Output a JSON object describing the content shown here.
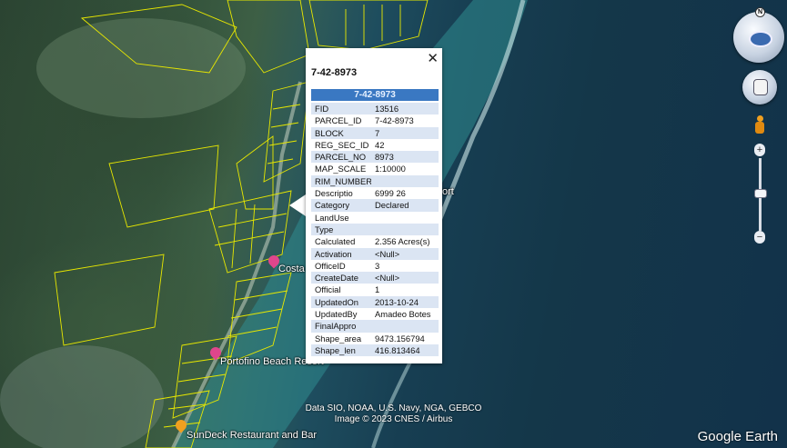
{
  "map": {
    "labels": {
      "costa": "Costa",
      "portofino": "Portofino Beach Resort",
      "sundeck": "SunDeck Restaurant and Bar",
      "ort": "ort"
    },
    "credits": {
      "line1": "Data SIO, NOAA, U.S. Navy, NGA, GEBCO",
      "line2": "Image © 2023 CNES / Airbus"
    },
    "logo": "Google Earth",
    "colors": {
      "parcel_lines": "#e8e800",
      "poi_pink": "#e0468c",
      "poi_orange": "#f0a020"
    }
  },
  "popup": {
    "title": "7-42-8973",
    "header": "7-42-8973",
    "close": "✕",
    "rows": [
      {
        "key": "FID",
        "value": "13516"
      },
      {
        "key": "PARCEL_ID",
        "value": "7-42-8973"
      },
      {
        "key": "BLOCK",
        "value": "7"
      },
      {
        "key": "REG_SEC_ID",
        "value": "42"
      },
      {
        "key": "PARCEL_NO",
        "value": "8973"
      },
      {
        "key": "MAP_SCALE",
        "value": "1:10000"
      },
      {
        "key": "RIM_NUMBER",
        "value": ""
      },
      {
        "key": "Descriptio",
        "value": "6999 26"
      },
      {
        "key": "Category",
        "value": "Declared"
      },
      {
        "key": "LandUse",
        "value": ""
      },
      {
        "key": "Type",
        "value": ""
      },
      {
        "key": "Calculated",
        "value": "2.356 Acres(s)"
      },
      {
        "key": "Activation",
        "value": "<Null>"
      },
      {
        "key": "OfficeID",
        "value": "3"
      },
      {
        "key": "CreateDate",
        "value": "<Null>"
      },
      {
        "key": "Official",
        "value": "1"
      },
      {
        "key": "UpdatedOn",
        "value": "2013-10-24"
      },
      {
        "key": "UpdatedBy",
        "value": "Amadeo Botes"
      },
      {
        "key": "FinalAppro",
        "value": ""
      },
      {
        "key": "Shape_area",
        "value": "9473.156794"
      },
      {
        "key": "Shape_len",
        "value": "416.813464"
      }
    ]
  },
  "nav": {
    "compass_letter": "N",
    "zoom_in": "+",
    "zoom_out": "−"
  }
}
